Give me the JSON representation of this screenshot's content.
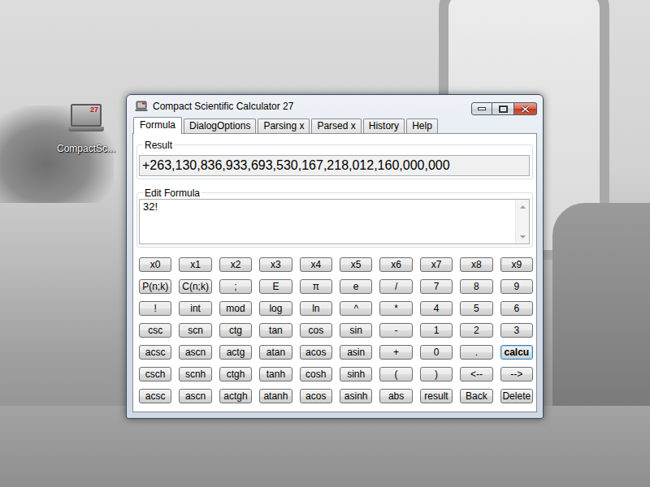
{
  "desktop_icon": {
    "badge": "27",
    "label": "CompactSc..."
  },
  "window": {
    "title": "Compact Scientific Calculator 27"
  },
  "tabs": [
    {
      "label": "Formula",
      "selected": true
    },
    {
      "label": "DialogOptions",
      "selected": false
    },
    {
      "label": "Parsing x",
      "selected": false
    },
    {
      "label": "Parsed x",
      "selected": false
    },
    {
      "label": "History",
      "selected": false
    },
    {
      "label": "Help",
      "selected": false
    }
  ],
  "result": {
    "label": "Result",
    "value": "+263,130,836,933,693,530,167,218,012,160,000,000"
  },
  "formula": {
    "label": "Edit Formula",
    "value": "32!"
  },
  "keys": [
    [
      {
        "label": "x0",
        "default": false
      },
      {
        "label": "x1",
        "default": false
      },
      {
        "label": "x2",
        "default": false
      },
      {
        "label": "x3",
        "default": false
      },
      {
        "label": "x4",
        "default": false
      },
      {
        "label": "x5",
        "default": false
      },
      {
        "label": "x6",
        "default": false
      },
      {
        "label": "x7",
        "default": false
      },
      {
        "label": "x8",
        "default": false
      },
      {
        "label": "x9",
        "default": false
      }
    ],
    [
      {
        "label": "P(n;k)",
        "default": false
      },
      {
        "label": "C(n;k)",
        "default": false
      },
      {
        "label": ";",
        "default": false
      },
      {
        "label": "E",
        "default": false
      },
      {
        "label": "π",
        "default": false
      },
      {
        "label": "e",
        "default": false
      },
      {
        "label": "/",
        "default": false
      },
      {
        "label": "7",
        "default": false
      },
      {
        "label": "8",
        "default": false
      },
      {
        "label": "9",
        "default": false
      }
    ],
    [
      {
        "label": "!",
        "default": false
      },
      {
        "label": "int",
        "default": false
      },
      {
        "label": "mod",
        "default": false
      },
      {
        "label": "log",
        "default": false
      },
      {
        "label": "ln",
        "default": false
      },
      {
        "label": "^",
        "default": false
      },
      {
        "label": "*",
        "default": false
      },
      {
        "label": "4",
        "default": false
      },
      {
        "label": "5",
        "default": false
      },
      {
        "label": "6",
        "default": false
      }
    ],
    [
      {
        "label": "csc",
        "default": false
      },
      {
        "label": "scn",
        "default": false
      },
      {
        "label": "ctg",
        "default": false
      },
      {
        "label": "tan",
        "default": false
      },
      {
        "label": "cos",
        "default": false
      },
      {
        "label": "sin",
        "default": false
      },
      {
        "label": "-",
        "default": false
      },
      {
        "label": "1",
        "default": false
      },
      {
        "label": "2",
        "default": false
      },
      {
        "label": "3",
        "default": false
      }
    ],
    [
      {
        "label": "acsc",
        "default": false
      },
      {
        "label": "ascn",
        "default": false
      },
      {
        "label": "actg",
        "default": false
      },
      {
        "label": "atan",
        "default": false
      },
      {
        "label": "acos",
        "default": false
      },
      {
        "label": "asin",
        "default": false
      },
      {
        "label": "+",
        "default": false
      },
      {
        "label": "0",
        "default": false
      },
      {
        "label": ".",
        "default": false
      },
      {
        "label": "calcu",
        "default": true
      }
    ],
    [
      {
        "label": "csch",
        "default": false
      },
      {
        "label": "scnh",
        "default": false
      },
      {
        "label": "ctgh",
        "default": false
      },
      {
        "label": "tanh",
        "default": false
      },
      {
        "label": "cosh",
        "default": false
      },
      {
        "label": "sinh",
        "default": false
      },
      {
        "label": "(",
        "default": false
      },
      {
        "label": ")",
        "default": false
      },
      {
        "label": "<--",
        "default": false
      },
      {
        "label": "-->",
        "default": false
      }
    ],
    [
      {
        "label": "acsc",
        "default": false
      },
      {
        "label": "ascn",
        "default": false
      },
      {
        "label": "actgh",
        "default": false
      },
      {
        "label": "atanh",
        "default": false
      },
      {
        "label": "acos",
        "default": false
      },
      {
        "label": "asinh",
        "default": false
      },
      {
        "label": "abs",
        "default": false
      },
      {
        "label": "result",
        "default": false
      },
      {
        "label": "Back",
        "default": false
      },
      {
        "label": "Delete",
        "default": false
      }
    ]
  ]
}
